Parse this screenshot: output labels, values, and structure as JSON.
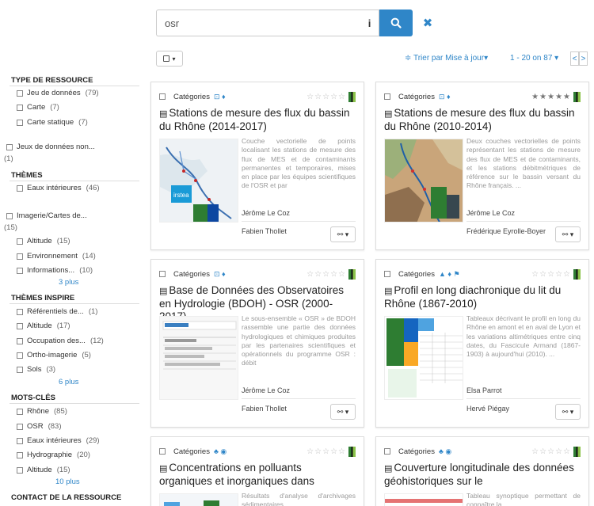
{
  "search": {
    "value": "osr",
    "info_label": "i",
    "clear_label": "✖"
  },
  "toolbar": {
    "sort_label": "≑ Trier par Mise à jour▾",
    "pagination_label": "1 - 20 on 87 ▾",
    "prev_label": "<",
    "next_label": ">",
    "select_label": "▾"
  },
  "facets": {
    "type_ressource": {
      "heading": "TYPE DE RESSOURCE",
      "items": [
        {
          "label": "Jeu de données",
          "count": "(79)"
        },
        {
          "label": "Carte",
          "count": "(7)"
        },
        {
          "label": "Carte statique",
          "count": "(7)"
        }
      ]
    },
    "jeux_non": {
      "label": "Jeux de données non...",
      "count": "(1)"
    },
    "themes": {
      "heading": "THÈMES",
      "items": [
        {
          "label": "Eaux intérieures",
          "count": "(46)"
        }
      ]
    },
    "imagerie": {
      "label": "Imagerie/Cartes de...",
      "count": "(15)",
      "items": [
        {
          "label": "Altitude",
          "count": "(15)"
        },
        {
          "label": "Environnement",
          "count": "(14)"
        },
        {
          "label": "Informations...",
          "count": "(10)"
        }
      ],
      "more": "3 plus"
    },
    "themes_inspire": {
      "heading": "THÈMES INSPIRE",
      "items": [
        {
          "label": "Référentiels de...",
          "count": "(1)"
        },
        {
          "label": "Altitude",
          "count": "(17)"
        },
        {
          "label": "Occupation des...",
          "count": "(12)"
        },
        {
          "label": "Ortho-imagerie",
          "count": "(5)"
        },
        {
          "label": "Sols",
          "count": "(3)"
        }
      ],
      "more": "6 plus"
    },
    "mots_cles": {
      "heading": "MOTS-CLÉS",
      "items": [
        {
          "label": "Rhône",
          "count": "(85)"
        },
        {
          "label": "OSR",
          "count": "(83)"
        },
        {
          "label": "Eaux intérieures",
          "count": "(29)"
        },
        {
          "label": "Hydrographie",
          "count": "(20)"
        },
        {
          "label": "Altitude",
          "count": "(15)"
        }
      ],
      "more": "10 plus"
    },
    "contact": {
      "heading": "CONTACT DE LA RESSOURCE"
    }
  },
  "cards": [
    {
      "category": "Catégories",
      "tags": "⊡ ♦",
      "stars": "☆☆☆☆☆",
      "title": "Stations de mesure des flux du bassin du Rhône (2014-2017)",
      "abstract": "Couche vectorielle de points localisant les stations de mesure des flux de MES et de contaminants permanentes et temporaires, mises en place par les équipes scientifiques de l'OSR et par",
      "author1": "Jérôme Le Coz",
      "author2": "Fabien Thollet",
      "action": "⚯ ▾",
      "thumb_logo": "irstea"
    },
    {
      "category": "Catégories",
      "tags": "⊡ ♦",
      "stars": "★★★★★",
      "title": "Stations de mesure des flux du bassin du Rhône (2010-2014)",
      "abstract": "Deux couches vectorielles de points représentant les stations de mesure des flux de MES et de contaminants, et les stations débitmétriques de référence sur le bassin versant du Rhône français. ...",
      "author1": "Jérôme Le Coz",
      "author2": "Frédérique Eyrolle-Boyer",
      "action": "⚯ ▾"
    },
    {
      "category": "Catégories",
      "tags": "⊡ ♦",
      "stars": "☆☆☆☆☆",
      "title": "Base de Données des Observatoires en Hydrologie (BDOH) - OSR (2000-2017)",
      "abstract": "Le sous-ensemble « OSR » de BDOH rassemble une partie des données hydrologiques et chimiques produites par les partenaires scientifiques et opérationnels du programme OSR : débit",
      "author1": "Jérôme Le Coz",
      "author2": "Fabien Thollet",
      "action": "⚯ ▾"
    },
    {
      "category": "Catégories",
      "tags": "▲ ♦ ⚑",
      "stars": "☆☆☆☆☆",
      "title": "Profil en long diachronique du lit du Rhône (1867-2010)",
      "abstract": "Tableaux décrivant le profil en long du Rhône en amont et en aval de Lyon et les variations altimétriques entre cinq dates, du Fascicule Armand (1867-1903) à aujourd'hui (2010). ...",
      "author1": "Elsa Parrot",
      "author2": "Hervé Piégay",
      "action": "⚯ ▾"
    },
    {
      "category": "Catégories",
      "tags": "♣ ◉",
      "stars": "☆☆☆☆☆",
      "title": "Concentrations en polluants organiques et inorganiques dans",
      "abstract": "Résultats d'analyse d'archivages sédimentaires",
      "author1": "",
      "author2": "",
      "action": ""
    },
    {
      "category": "Catégories",
      "tags": "♣ ◉",
      "stars": "☆☆☆☆☆",
      "title": "Couverture longitudinale des données géohistoriques sur le",
      "abstract": "Tableau synoptique permettant de connaître la",
      "author1": "",
      "author2": "",
      "action": ""
    }
  ]
}
